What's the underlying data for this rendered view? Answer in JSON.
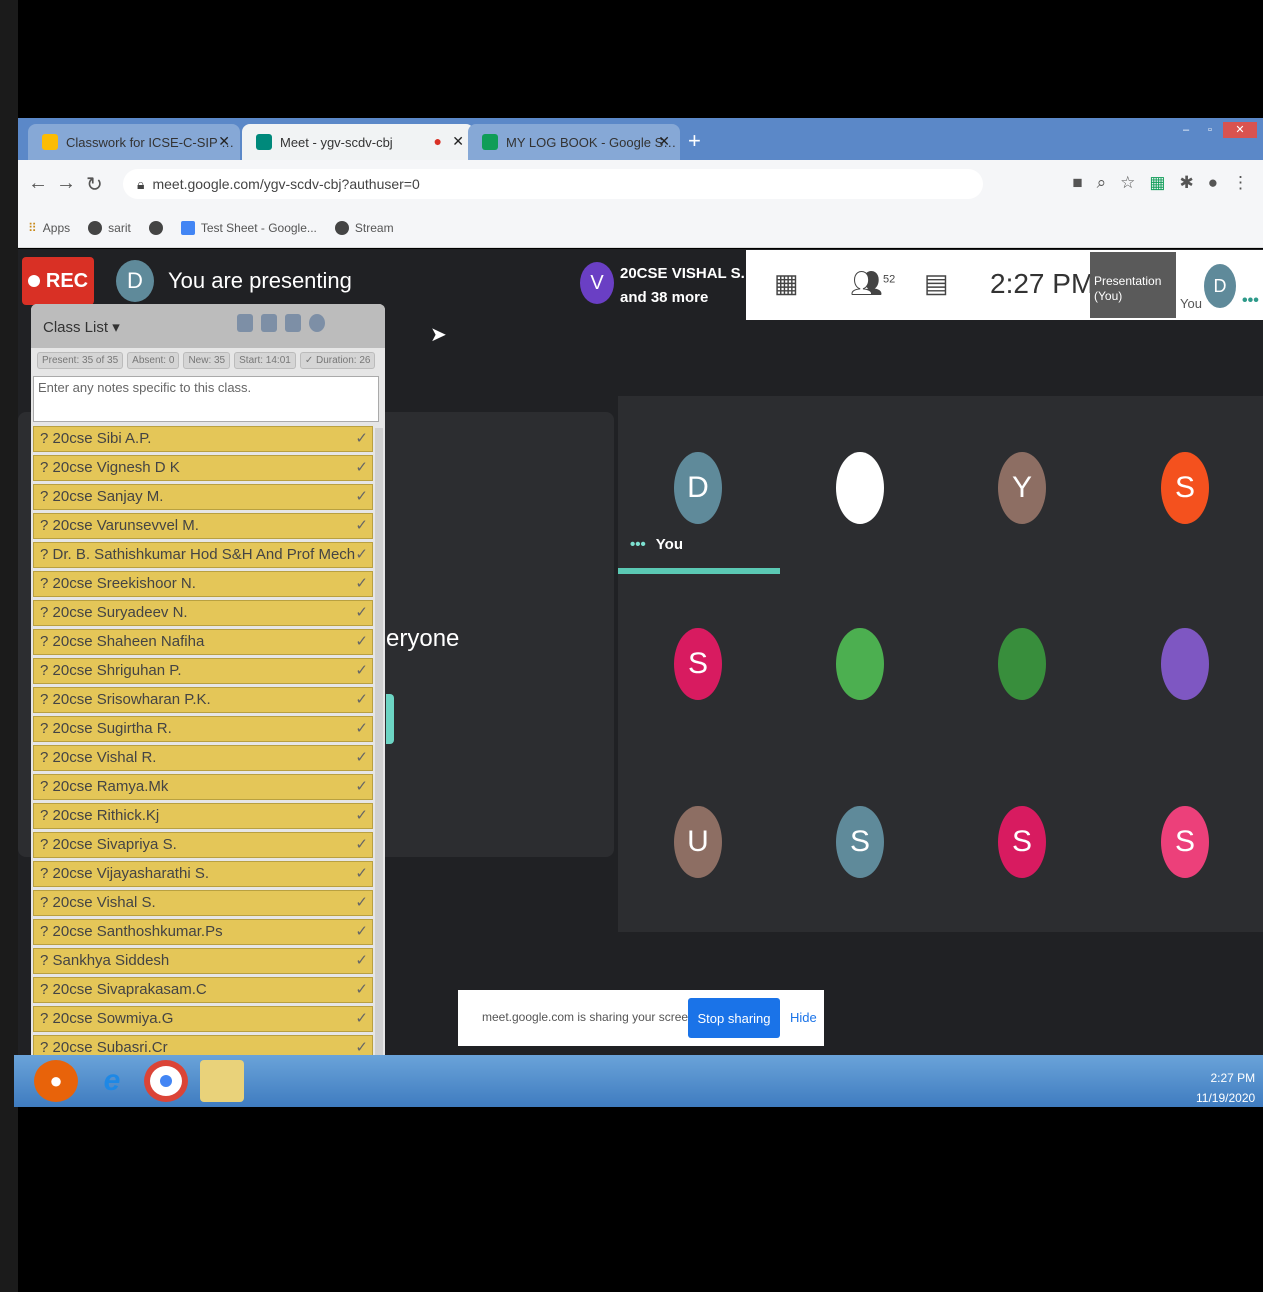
{
  "browser": {
    "tabs": [
      {
        "label": "Classwork for ICSE-C-SIP Studen"
      },
      {
        "label": "Meet - ygv-scdv-cbj"
      },
      {
        "label": "MY LOG BOOK - Google Sheets"
      }
    ],
    "url": "meet.google.com/ygv-scdv-cbj?authuser=0",
    "bookmarks": [
      "Apps",
      "sarit",
      "Test Sheet - Google...",
      "Stream"
    ]
  },
  "meet": {
    "rec_label": "REC",
    "presenter_initial": "D",
    "presenting_text": "You are presenting",
    "top_participant": {
      "initial": "V",
      "name": "20CSE VISHAL S.",
      "more": "and 38 more"
    },
    "people_count": "52",
    "time": "2:27 PM",
    "presentation_thumb_label": "Presentation (You)",
    "you_label": "You",
    "self_initial": "D",
    "card_text": "eryone",
    "tile_you_label": "You",
    "tiles": [
      {
        "initial": "D",
        "color": "#5f8a9a"
      },
      {
        "initial": "",
        "color": "#ffffff"
      },
      {
        "initial": "Y",
        "color": "#8d6e63"
      },
      {
        "initial": "S",
        "color": "#f4511e"
      },
      {
        "initial": "S",
        "color": "#d81b60"
      },
      {
        "initial": "",
        "color": "#4caf50"
      },
      {
        "initial": "",
        "color": "#388e3c"
      },
      {
        "initial": "",
        "color": "#7e57c2"
      },
      {
        "initial": "U",
        "color": "#8d6e63"
      },
      {
        "initial": "S",
        "color": "#5f8a9a"
      },
      {
        "initial": "S",
        "color": "#d81b60"
      },
      {
        "initial": "S",
        "color": "#ec407a"
      }
    ]
  },
  "classlist": {
    "title": "Class List",
    "stats": [
      "Present: 35 of 35",
      "Absent: 0",
      "New: 35",
      "Start: 14:01",
      "✓ Duration: 26"
    ],
    "notes_placeholder": "Enter any notes specific to this class.",
    "students": [
      "? 20cse Sibi A.P.",
      "? 20cse Vignesh D K",
      "? 20cse Sanjay M.",
      "? 20cse Varunsevvel M.",
      "? Dr. B. Sathishkumar Hod S&H And Prof Mech",
      "? 20cse Sreekishoor N.",
      "? 20cse Suryadeev N.",
      "? 20cse Shaheen Nafiha",
      "? 20cse Shriguhan P.",
      "? 20cse Srisowharan P.K.",
      "? 20cse Sugirtha R.",
      "? 20cse Vishal R.",
      "? 20cse Ramya.Mk",
      "? 20cse Rithick.Kj",
      "? 20cse Sivapriya S.",
      "? 20cse Vijayasharathi S.",
      "? 20cse Vishal S.",
      "? 20cse Santhoshkumar.Ps",
      "? Sankhya Siddesh",
      "? 20cse Sivaprakasam.C",
      "? 20cse Sowmiya.G",
      "? 20cse Subasri.Cr"
    ]
  },
  "share_banner": {
    "text": "meet.google.com is sharing your screen.",
    "stop_label": "Stop sharing",
    "hide_label": "Hide"
  },
  "taskbar": {
    "time": "2:27 PM",
    "date": "11/19/2020"
  }
}
